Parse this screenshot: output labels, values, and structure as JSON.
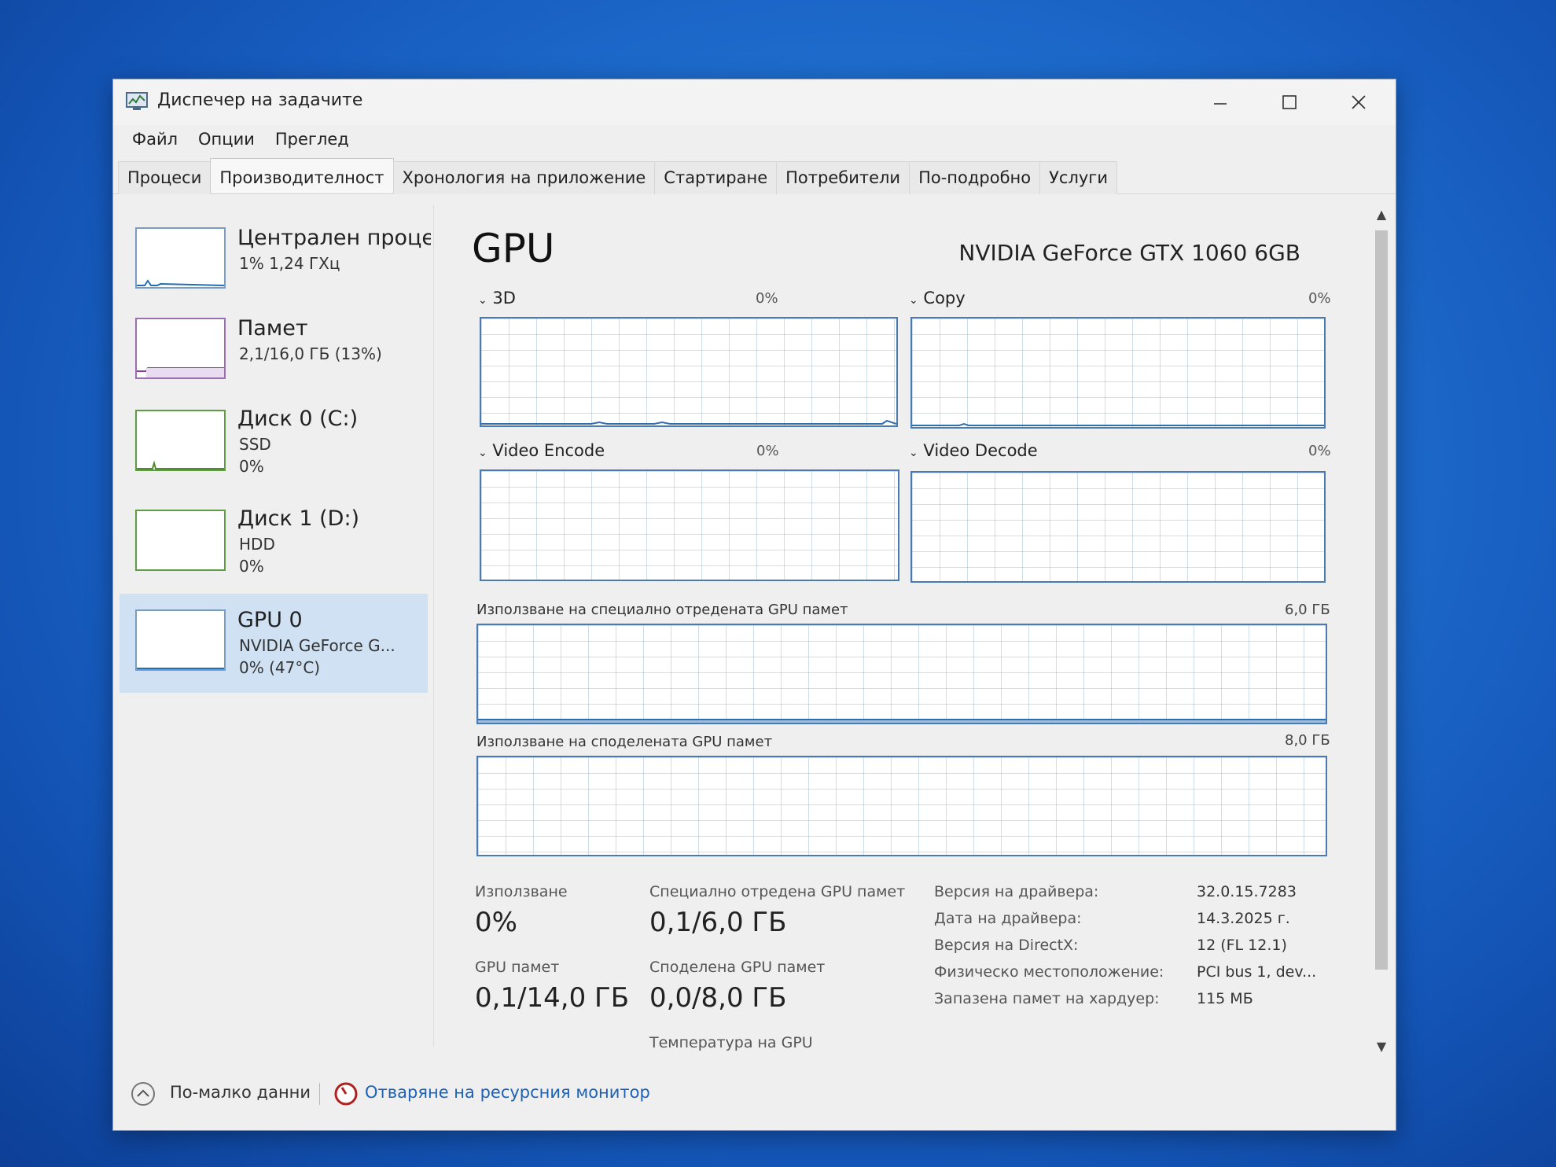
{
  "window": {
    "title": "Диспечер на задачите",
    "icon": "task-manager-icon"
  },
  "menu": [
    "Файл",
    "Опции",
    "Преглед"
  ],
  "tabs": [
    "Процеси",
    "Производителност",
    "Хронология на приложение",
    "Стартиране",
    "Потребители",
    "По-подробно",
    "Услуги"
  ],
  "active_tab": "Производителност",
  "sidebar": {
    "items": [
      {
        "title": "Централен процесор",
        "lines": [
          "1% 1,24 ГХц"
        ],
        "color": "#1f6fb5"
      },
      {
        "title": "Памет",
        "lines": [
          "2,1/16,0 ГБ (13%)"
        ],
        "color": "#8b3ea3"
      },
      {
        "title": "Диск 0 (C:)",
        "lines": [
          "SSD",
          "0%"
        ],
        "color": "#4c8a2d"
      },
      {
        "title": "Диск 1 (D:)",
        "lines": [
          "HDD",
          "0%"
        ],
        "color": "#4c8a2d"
      },
      {
        "title": "GPU 0",
        "lines": [
          "NVIDIA GeForce G...",
          "0% (47°C)"
        ],
        "color": "#1f6fb5",
        "selected": true
      }
    ]
  },
  "main": {
    "title": "GPU",
    "gpu_name": "NVIDIA GeForce GTX 1060 6GB",
    "engines": [
      {
        "label": "3D",
        "percent": "0%"
      },
      {
        "label": "Copy",
        "percent": "0%"
      },
      {
        "label": "Video Encode",
        "percent": "0%"
      },
      {
        "label": "Video Decode",
        "percent": "0%"
      }
    ],
    "dedicated_memory": {
      "label": "Използване на специално отредената GPU памет",
      "max": "6,0 ГБ"
    },
    "shared_memory": {
      "label": "Използване на споделената GPU памет",
      "max": "8,0 ГБ"
    },
    "stats": {
      "utilization": {
        "label": "Използване",
        "value": "0%"
      },
      "dedicated": {
        "label": "Специално отредена GPU памет",
        "value": "0,1/6,0 ГБ"
      },
      "gpu_memory": {
        "label": "GPU памет",
        "value": "0,1/14,0 ГБ"
      },
      "shared": {
        "label": "Споделена GPU памет",
        "value": "0,0/8,0 ГБ"
      },
      "temperature_label": "Температура на GPU"
    },
    "info": [
      {
        "label": "Версия на драйвера:",
        "value": "32.0.15.7283"
      },
      {
        "label": "Дата на драйвера:",
        "value": "14.3.2025 г."
      },
      {
        "label": "Версия на DirectX:",
        "value": "12 (FL 12.1)"
      },
      {
        "label": "Физическо местоположение:",
        "value": "PCI bus 1, dev..."
      },
      {
        "label": "Запазена памет на хардуер:",
        "value": "115 МБ"
      }
    ]
  },
  "footer": {
    "fewer_details": "По-малко данни",
    "resource_monitor": "Отваряне на ресурсния монитор"
  }
}
